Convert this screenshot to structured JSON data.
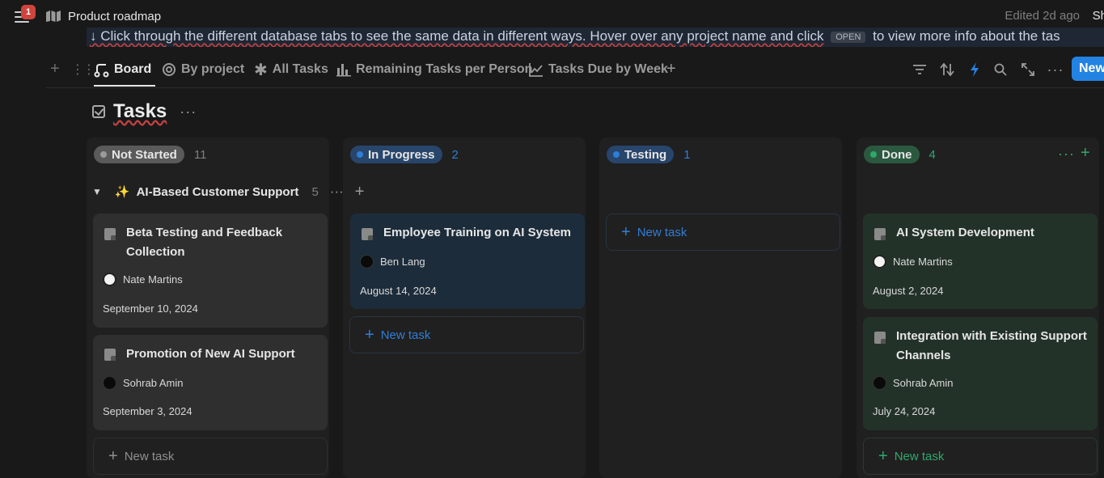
{
  "header": {
    "notifications": "1",
    "breadcrumb": "Product roadmap",
    "edited": "Edited 2d ago",
    "share_partial": "Sh"
  },
  "callout": {
    "text_before": "↓ Click through the different database tabs to see the same data in different ways. Hover over any project name and click",
    "chip": "OPEN",
    "text_after": "to view more info about the tas"
  },
  "views": {
    "tabs": [
      {
        "label": "Board",
        "icon": "board-icon",
        "active": true
      },
      {
        "label": "By project",
        "icon": "target-icon"
      },
      {
        "label": "All Tasks",
        "icon": "asterisk-icon"
      },
      {
        "label": "Remaining Tasks per Person",
        "icon": "bar-chart-icon"
      },
      {
        "label": "Tasks Due by Week",
        "icon": "line-chart-icon"
      }
    ],
    "new_label": "New"
  },
  "database": {
    "title": "Tasks"
  },
  "columns": [
    {
      "label": "Not Started",
      "count": "11",
      "color": "#5a5a5a",
      "dot": "#9b9b9b"
    },
    {
      "label": "In Progress",
      "count": "2",
      "color": "#28456c",
      "dot": "#2e7ed7"
    },
    {
      "label": "Testing",
      "count": "1",
      "color": "#28456c",
      "dot": "#2e7ed7"
    },
    {
      "label": "Done",
      "count": "4",
      "color": "#2b5940",
      "dot": "#2ea86b"
    }
  ],
  "group": {
    "icon": "sparkles-icon",
    "emoji": "✨",
    "label": "AI-Based Customer Support",
    "count": "5"
  },
  "cards": {
    "not_started": [
      {
        "title_l1": "Beta Testing and Feedback",
        "title_l2": "Collection",
        "person": "Nate Martins",
        "date": "September 10, 2024"
      },
      {
        "title_l1": "Promotion of New AI Support",
        "person": "Sohrab Amin",
        "date": "September 3, 2024"
      }
    ],
    "in_progress": [
      {
        "title_l1": "Employee Training on AI System",
        "person": "Ben Lang",
        "date": "August 14, 2024"
      }
    ],
    "done": [
      {
        "title_l1": "AI System Development",
        "person": "Nate Martins",
        "date": "August 2, 2024"
      },
      {
        "title_l1": "Integration with Existing Support",
        "title_l2": "Channels",
        "person": "Sohrab Amin",
        "date": "July 24, 2024"
      }
    ]
  },
  "new_task_label": "New task",
  "colors": {
    "background": "#191919",
    "accent": "#2383e2",
    "card_default": "#2f2f2f",
    "card_blue": "#1d2c3b",
    "card_green": "#233228"
  }
}
